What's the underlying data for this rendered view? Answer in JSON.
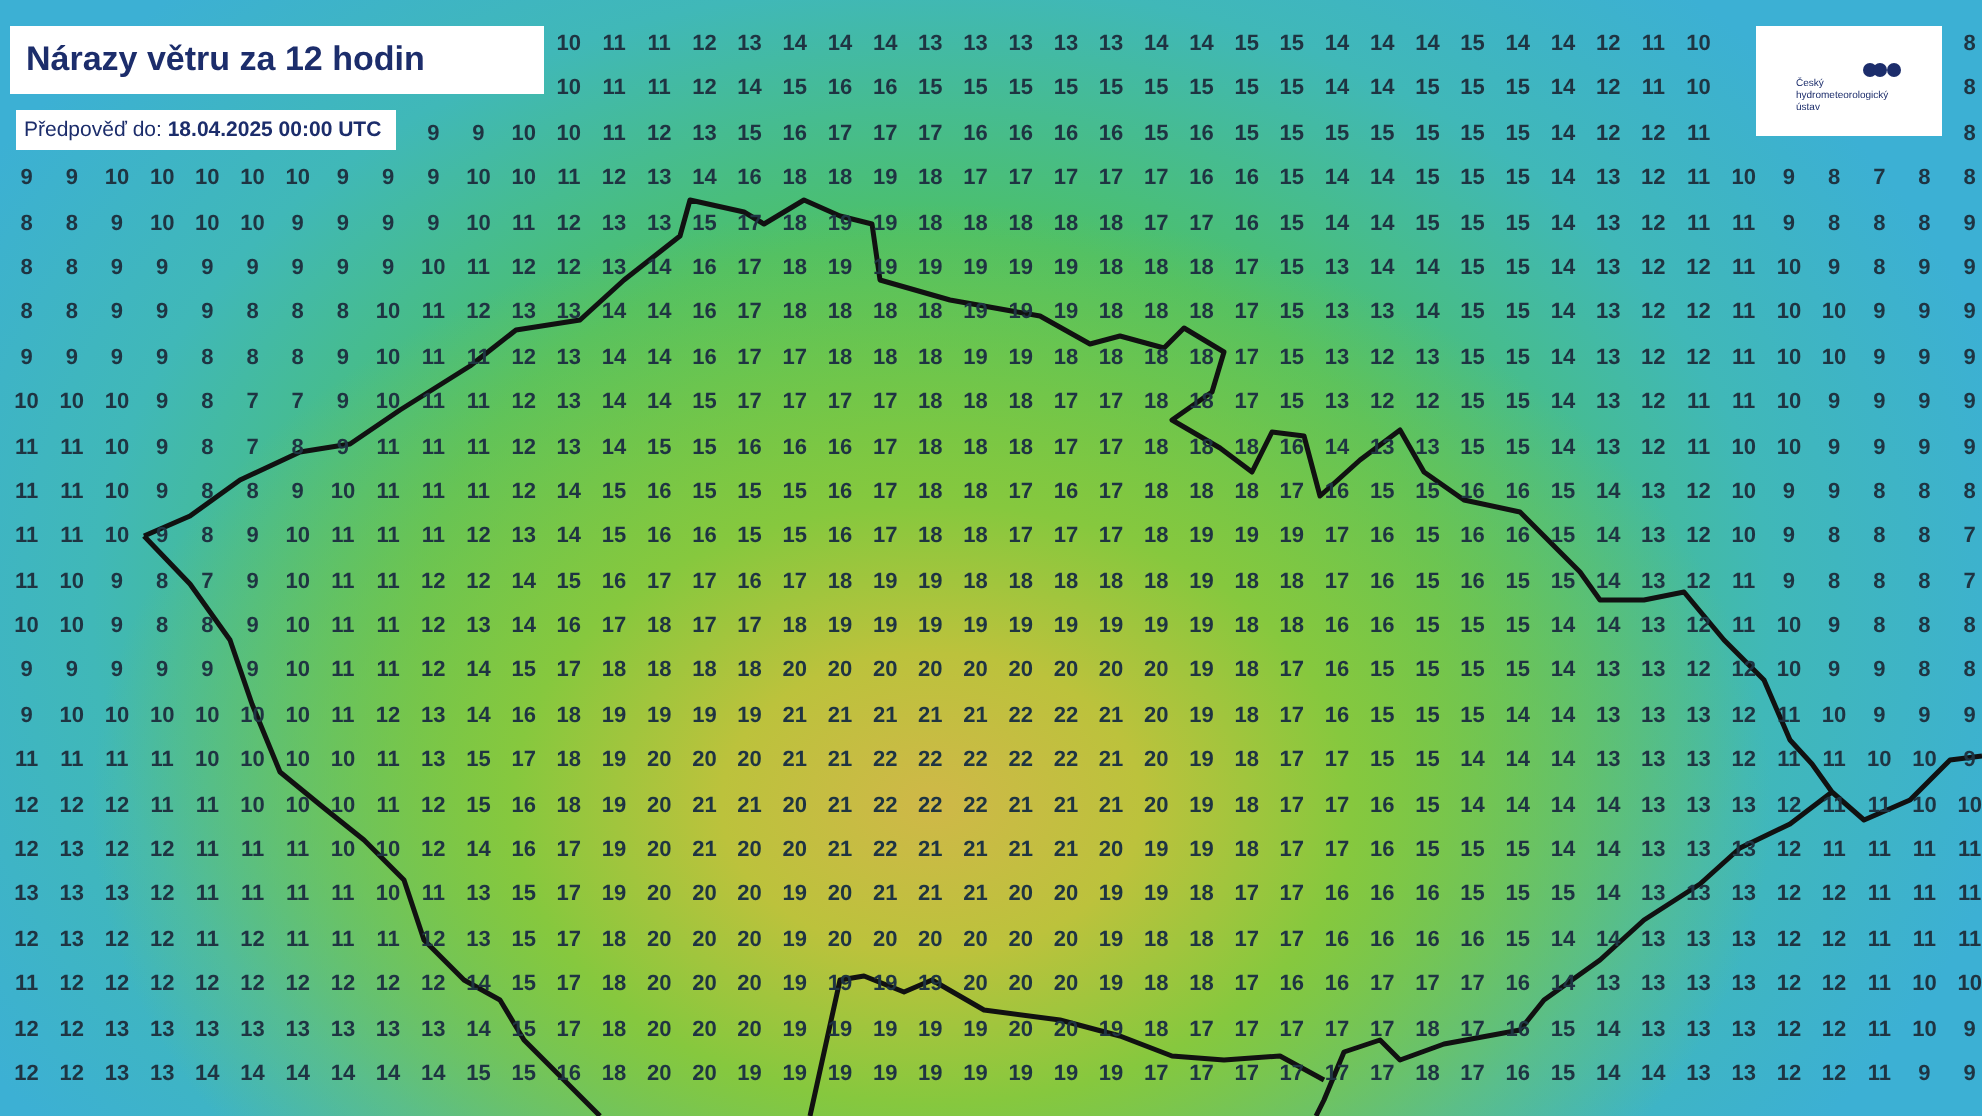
{
  "map": {
    "title": "Nárazy větru za 12 hodin",
    "forecast": "Předpověď do: **18.04.2025 00:00 UTC**",
    "logo_text": "Český hydrometeorologický ústav",
    "gust_rows": [
      {
        "values": [
          "10",
          "11",
          "11",
          "12",
          "13",
          "14",
          "14",
          "14",
          "13",
          "13",
          "13",
          "13",
          "13",
          "14",
          "14",
          "15",
          "15",
          "14",
          "14",
          "14",
          "15",
          "14",
          "14",
          "12",
          "11",
          "10"
        ],
        "edge_value": "8"
      },
      {
        "values": [
          "10",
          "11",
          "11",
          "12",
          "14",
          "15",
          "16",
          "16",
          "15",
          "15",
          "15",
          "15",
          "15",
          "15",
          "15",
          "15",
          "15",
          "14",
          "14",
          "15",
          "15",
          "15",
          "14",
          "12",
          "11",
          "10"
        ],
        "edge_value": "8"
      },
      {
        "values": [
          "9",
          "9",
          "10",
          "10",
          "11",
          "12",
          "13",
          "15",
          "16",
          "17",
          "17",
          "17",
          "16",
          "16",
          "16",
          "16",
          "15",
          "16",
          "15",
          "15",
          "15",
          "15",
          "15",
          "15",
          "15",
          "14",
          "12",
          "12",
          "11"
        ],
        "edge_value": "8"
      },
      {
        "values": [
          "9",
          "9",
          "10",
          "10",
          "10",
          "10",
          "10",
          "9",
          "9",
          "9",
          "10",
          "10",
          "11",
          "12",
          "13",
          "14",
          "16",
          "18",
          "18",
          "19",
          "18",
          "17",
          "17",
          "17",
          "17",
          "17",
          "16",
          "16",
          "15",
          "14",
          "14",
          "15",
          "15",
          "15",
          "14",
          "13",
          "12",
          "11",
          "10",
          "9",
          "8",
          "7",
          "8",
          "8"
        ]
      },
      {
        "values": [
          "8",
          "8",
          "9",
          "10",
          "10",
          "10",
          "9",
          "9",
          "9",
          "9",
          "10",
          "11",
          "12",
          "13",
          "13",
          "15",
          "17",
          "18",
          "19",
          "19",
          "18",
          "18",
          "18",
          "18",
          "18",
          "17",
          "17",
          "16",
          "15",
          "14",
          "14",
          "15",
          "15",
          "15",
          "14",
          "13",
          "12",
          "11",
          "11",
          "9",
          "8",
          "8",
          "8",
          "9"
        ]
      },
      {
        "values": [
          "8",
          "8",
          "9",
          "9",
          "9",
          "9",
          "9",
          "9",
          "9",
          "10",
          "11",
          "12",
          "12",
          "13",
          "14",
          "16",
          "17",
          "18",
          "19",
          "19",
          "19",
          "19",
          "19",
          "19",
          "18",
          "18",
          "18",
          "17",
          "15",
          "13",
          "14",
          "14",
          "15",
          "15",
          "14",
          "13",
          "12",
          "12",
          "11",
          "10",
          "9",
          "8",
          "9",
          "9"
        ]
      },
      {
        "values": [
          "8",
          "8",
          "9",
          "9",
          "9",
          "8",
          "8",
          "8",
          "10",
          "11",
          "12",
          "13",
          "13",
          "14",
          "14",
          "16",
          "17",
          "18",
          "18",
          "18",
          "18",
          "19",
          "19",
          "19",
          "18",
          "18",
          "18",
          "17",
          "15",
          "13",
          "13",
          "14",
          "15",
          "15",
          "14",
          "13",
          "12",
          "12",
          "11",
          "10",
          "10",
          "9",
          "9",
          "9"
        ]
      },
      {
        "values": [
          "9",
          "9",
          "9",
          "9",
          "8",
          "8",
          "8",
          "9",
          "10",
          "11",
          "11",
          "12",
          "13",
          "14",
          "14",
          "16",
          "17",
          "17",
          "18",
          "18",
          "18",
          "19",
          "19",
          "18",
          "18",
          "18",
          "18",
          "17",
          "15",
          "13",
          "12",
          "13",
          "15",
          "15",
          "14",
          "13",
          "12",
          "12",
          "11",
          "10",
          "10",
          "9",
          "9",
          "9"
        ]
      },
      {
        "values": [
          "10",
          "10",
          "10",
          "9",
          "8",
          "7",
          "7",
          "9",
          "10",
          "11",
          "11",
          "12",
          "13",
          "14",
          "14",
          "15",
          "17",
          "17",
          "17",
          "17",
          "18",
          "18",
          "18",
          "17",
          "17",
          "18",
          "18",
          "17",
          "15",
          "13",
          "12",
          "12",
          "15",
          "15",
          "14",
          "13",
          "12",
          "11",
          "11",
          "10",
          "9",
          "9",
          "9",
          "9"
        ]
      },
      {
        "values": [
          "11",
          "11",
          "10",
          "9",
          "8",
          "7",
          "8",
          "9",
          "11",
          "11",
          "11",
          "12",
          "13",
          "14",
          "15",
          "15",
          "16",
          "16",
          "16",
          "17",
          "18",
          "18",
          "18",
          "17",
          "17",
          "18",
          "18",
          "18",
          "16",
          "14",
          "13",
          "13",
          "15",
          "15",
          "14",
          "13",
          "12",
          "11",
          "10",
          "10",
          "9",
          "9",
          "9",
          "9"
        ]
      },
      {
        "values": [
          "11",
          "11",
          "10",
          "9",
          "8",
          "8",
          "9",
          "10",
          "11",
          "11",
          "11",
          "12",
          "14",
          "15",
          "16",
          "15",
          "15",
          "15",
          "16",
          "17",
          "18",
          "18",
          "17",
          "16",
          "17",
          "18",
          "18",
          "18",
          "17",
          "16",
          "15",
          "15",
          "16",
          "16",
          "15",
          "14",
          "13",
          "12",
          "10",
          "9",
          "9",
          "8",
          "8",
          "8"
        ]
      },
      {
        "values": [
          "11",
          "11",
          "10",
          "9",
          "8",
          "9",
          "10",
          "11",
          "11",
          "11",
          "12",
          "13",
          "14",
          "15",
          "16",
          "16",
          "15",
          "15",
          "16",
          "17",
          "18",
          "18",
          "17",
          "17",
          "17",
          "18",
          "19",
          "19",
          "19",
          "17",
          "16",
          "15",
          "16",
          "16",
          "15",
          "14",
          "13",
          "12",
          "10",
          "9",
          "8",
          "8",
          "8",
          "7"
        ]
      },
      {
        "values": [
          "11",
          "10",
          "9",
          "8",
          "7",
          "9",
          "10",
          "11",
          "11",
          "12",
          "12",
          "14",
          "15",
          "16",
          "17",
          "17",
          "16",
          "17",
          "18",
          "19",
          "19",
          "18",
          "18",
          "18",
          "18",
          "18",
          "19",
          "18",
          "18",
          "17",
          "16",
          "15",
          "16",
          "15",
          "15",
          "14",
          "13",
          "12",
          "11",
          "9",
          "8",
          "8",
          "8",
          "7"
        ]
      },
      {
        "values": [
          "10",
          "10",
          "9",
          "8",
          "8",
          "9",
          "10",
          "11",
          "11",
          "12",
          "13",
          "14",
          "16",
          "17",
          "18",
          "17",
          "17",
          "18",
          "19",
          "19",
          "19",
          "19",
          "19",
          "19",
          "19",
          "19",
          "19",
          "18",
          "18",
          "16",
          "16",
          "15",
          "15",
          "15",
          "14",
          "14",
          "13",
          "12",
          "11",
          "10",
          "9",
          "8",
          "8",
          "8"
        ]
      },
      {
        "values": [
          "9",
          "9",
          "9",
          "9",
          "9",
          "9",
          "10",
          "11",
          "11",
          "12",
          "14",
          "15",
          "17",
          "18",
          "18",
          "18",
          "18",
          "20",
          "20",
          "20",
          "20",
          "20",
          "20",
          "20",
          "20",
          "20",
          "19",
          "18",
          "17",
          "16",
          "15",
          "15",
          "15",
          "15",
          "14",
          "13",
          "13",
          "12",
          "12",
          "10",
          "9",
          "9",
          "8",
          "8"
        ]
      },
      {
        "values": [
          "9",
          "10",
          "10",
          "10",
          "10",
          "10",
          "10",
          "11",
          "12",
          "13",
          "14",
          "16",
          "18",
          "19",
          "19",
          "19",
          "19",
          "21",
          "21",
          "21",
          "21",
          "21",
          "22",
          "22",
          "21",
          "20",
          "19",
          "18",
          "17",
          "16",
          "15",
          "15",
          "15",
          "14",
          "14",
          "13",
          "13",
          "13",
          "12",
          "11",
          "10",
          "9",
          "9",
          "9"
        ]
      },
      {
        "values": [
          "11",
          "11",
          "11",
          "11",
          "10",
          "10",
          "10",
          "10",
          "11",
          "13",
          "15",
          "17",
          "18",
          "19",
          "20",
          "20",
          "20",
          "21",
          "21",
          "22",
          "22",
          "22",
          "22",
          "22",
          "21",
          "20",
          "19",
          "18",
          "17",
          "17",
          "15",
          "15",
          "14",
          "14",
          "14",
          "13",
          "13",
          "13",
          "12",
          "11",
          "11",
          "10",
          "10",
          "9"
        ]
      },
      {
        "values": [
          "12",
          "12",
          "12",
          "11",
          "11",
          "10",
          "10",
          "10",
          "11",
          "12",
          "15",
          "16",
          "18",
          "19",
          "20",
          "21",
          "21",
          "20",
          "21",
          "22",
          "22",
          "22",
          "21",
          "21",
          "21",
          "20",
          "19",
          "18",
          "17",
          "17",
          "16",
          "15",
          "14",
          "14",
          "14",
          "14",
          "13",
          "13",
          "13",
          "12",
          "11",
          "11",
          "10",
          "10"
        ]
      },
      {
        "values": [
          "12",
          "13",
          "12",
          "12",
          "11",
          "11",
          "11",
          "10",
          "10",
          "12",
          "14",
          "16",
          "17",
          "19",
          "20",
          "21",
          "20",
          "20",
          "21",
          "22",
          "21",
          "21",
          "21",
          "21",
          "20",
          "19",
          "19",
          "18",
          "17",
          "17",
          "16",
          "15",
          "15",
          "15",
          "14",
          "14",
          "13",
          "13",
          "13",
          "12",
          "11",
          "11",
          "11",
          "11"
        ]
      },
      {
        "values": [
          "13",
          "13",
          "13",
          "12",
          "11",
          "11",
          "11",
          "11",
          "10",
          "11",
          "13",
          "15",
          "17",
          "19",
          "20",
          "20",
          "20",
          "19",
          "20",
          "21",
          "21",
          "21",
          "20",
          "20",
          "19",
          "19",
          "18",
          "17",
          "17",
          "16",
          "16",
          "16",
          "15",
          "15",
          "15",
          "14",
          "13",
          "13",
          "13",
          "12",
          "12",
          "11",
          "11",
          "11"
        ]
      },
      {
        "values": [
          "12",
          "13",
          "12",
          "12",
          "11",
          "12",
          "11",
          "11",
          "11",
          "12",
          "13",
          "15",
          "17",
          "18",
          "20",
          "20",
          "20",
          "19",
          "20",
          "20",
          "20",
          "20",
          "20",
          "20",
          "19",
          "18",
          "18",
          "17",
          "17",
          "16",
          "16",
          "16",
          "16",
          "15",
          "14",
          "14",
          "13",
          "13",
          "13",
          "12",
          "12",
          "11",
          "11",
          "11"
        ]
      },
      {
        "values": [
          "11",
          "12",
          "12",
          "12",
          "12",
          "12",
          "12",
          "12",
          "12",
          "12",
          "14",
          "15",
          "17",
          "18",
          "20",
          "20",
          "20",
          "19",
          "19",
          "19",
          "19",
          "20",
          "20",
          "20",
          "19",
          "18",
          "18",
          "17",
          "16",
          "16",
          "17",
          "17",
          "17",
          "16",
          "14",
          "13",
          "13",
          "13",
          "13",
          "12",
          "12",
          "11",
          "10",
          "10"
        ]
      },
      {
        "values": [
          "12",
          "12",
          "13",
          "13",
          "13",
          "13",
          "13",
          "13",
          "13",
          "13",
          "14",
          "15",
          "17",
          "18",
          "20",
          "20",
          "20",
          "19",
          "19",
          "19",
          "19",
          "19",
          "20",
          "20",
          "19",
          "18",
          "17",
          "17",
          "17",
          "17",
          "17",
          "18",
          "17",
          "16",
          "15",
          "14",
          "13",
          "13",
          "13",
          "12",
          "12",
          "11",
          "10",
          "9"
        ]
      },
      {
        "values": [
          "12",
          "12",
          "13",
          "13",
          "14",
          "14",
          "14",
          "14",
          "14",
          "14",
          "15",
          "15",
          "16",
          "18",
          "20",
          "20",
          "19",
          "19",
          "19",
          "19",
          "19",
          "19",
          "19",
          "19",
          "19",
          "17",
          "17",
          "17",
          "17",
          "17",
          "17",
          "18",
          "17",
          "16",
          "15",
          "14",
          "14",
          "13",
          "13",
          "12",
          "12",
          "11",
          "9",
          "9"
        ]
      }
    ]
  }
}
